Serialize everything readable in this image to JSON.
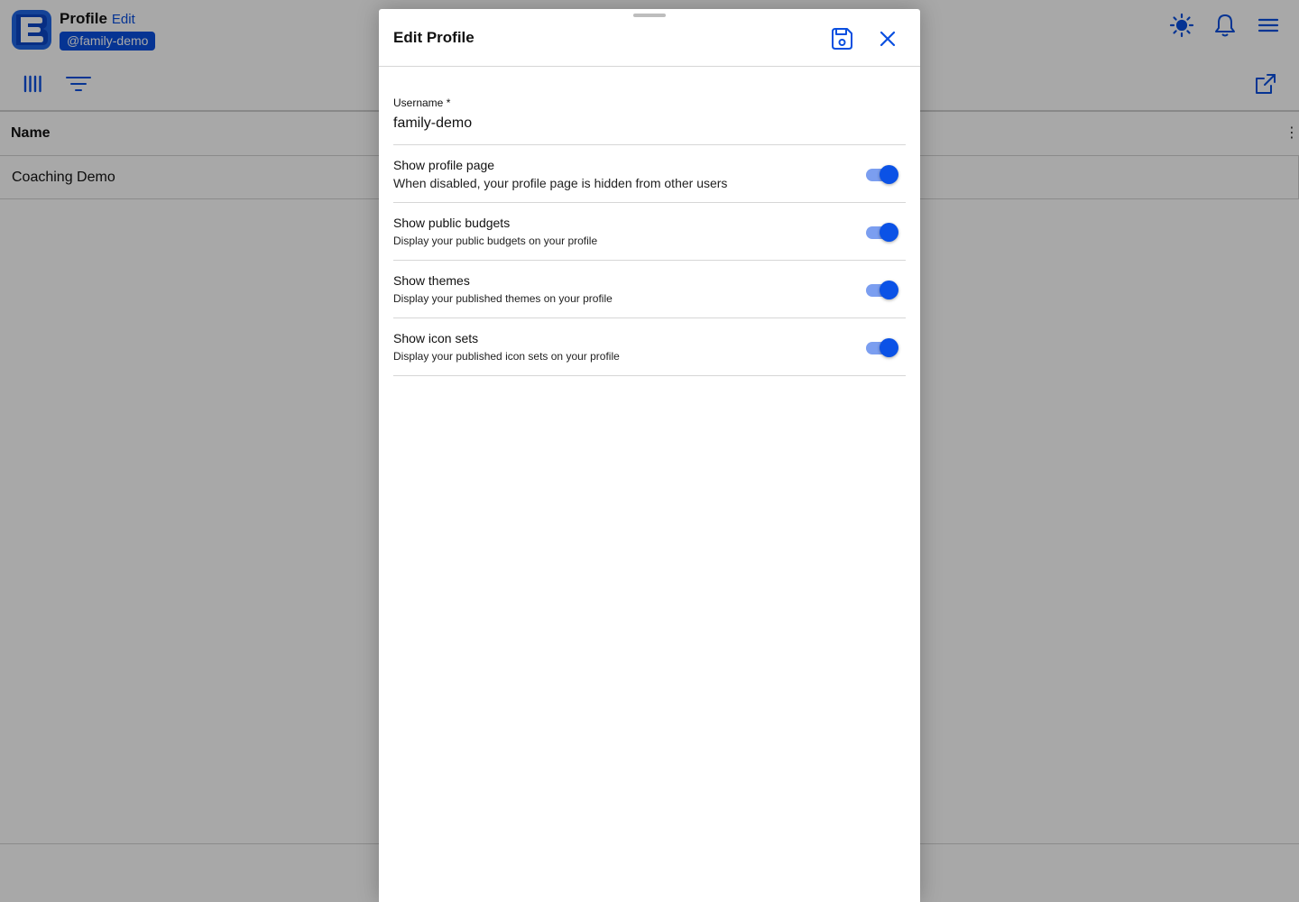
{
  "app": {
    "title": "Profile",
    "edit_link": "Edit",
    "handle": "@family-demo",
    "logo_letter": "E",
    "accent_color": "#0a4fe0",
    "top_icons": [
      "sun-icon",
      "bell-icon",
      "hamburger-menu-icon"
    ],
    "toolbar_icons": [
      "columns-icon",
      "filter-icon",
      "external-link-icon"
    ]
  },
  "table": {
    "columns": [
      "Name"
    ],
    "rows": [
      {
        "name": "Coaching Demo"
      }
    ]
  },
  "modal": {
    "title": "Edit Profile",
    "save_icon": "save-icon",
    "close_icon": "close-icon",
    "username": {
      "label": "Username *",
      "value": "family-demo"
    },
    "settings": [
      {
        "title": "Show profile page",
        "description": "When disabled, your profile page is hidden from other users",
        "enabled": true
      },
      {
        "title": "Show public budgets",
        "description": "Display your public budgets on your profile",
        "enabled": true
      },
      {
        "title": "Show themes",
        "description": "Display your published themes on your profile",
        "enabled": true
      },
      {
        "title": "Show icon sets",
        "description": "Display your published icon sets on your profile",
        "enabled": true
      }
    ]
  }
}
